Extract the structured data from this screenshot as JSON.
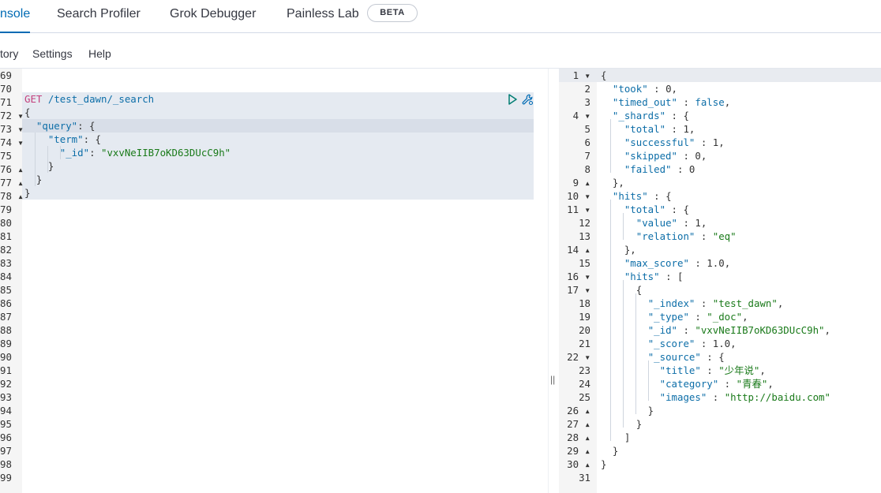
{
  "tabs": {
    "console": "nsole",
    "search_profiler": "Search Profiler",
    "grok_debugger": "Grok Debugger",
    "painless_lab": "Painless Lab",
    "beta_badge": "BETA"
  },
  "menu": {
    "history": "tory",
    "settings": "Settings",
    "help": "Help"
  },
  "request_editor": {
    "line_numbers": [
      "69",
      "70",
      "71",
      "72",
      "73",
      "74",
      "75",
      "76",
      "77",
      "78",
      "79",
      "80",
      "81",
      "82",
      "83",
      "84",
      "85",
      "86",
      "87",
      "88",
      "89",
      "90",
      "91",
      "92",
      "93",
      "94",
      "95",
      "96",
      "97",
      "98",
      "99"
    ],
    "method": "GET",
    "path": "/test_dawn/_search",
    "query_key": "\"query\"",
    "term_key": "\"term\"",
    "id_key": "\"_id\"",
    "id_value": "\"vxvNeIIB7oKD63DUcC9h\""
  },
  "response_editor": {
    "line_numbers": [
      "1",
      "2",
      "3",
      "4",
      "5",
      "6",
      "7",
      "8",
      "9",
      "10",
      "11",
      "12",
      "13",
      "14",
      "15",
      "16",
      "17",
      "18",
      "19",
      "20",
      "21",
      "22",
      "23",
      "24",
      "25",
      "26",
      "27",
      "28",
      "29",
      "30",
      "31"
    ],
    "took_key": "\"took\"",
    "took": "0",
    "timed_out_key": "\"timed_out\"",
    "timed_out": "false",
    "shards_key": "\"_shards\"",
    "total_key": "\"total\"",
    "total": "1",
    "successful_key": "\"successful\"",
    "successful": "1",
    "skipped_key": "\"skipped\"",
    "skipped": "0",
    "failed_key": "\"failed\"",
    "failed": "0",
    "hits_key": "\"hits\"",
    "value_key": "\"value\"",
    "value": "1",
    "relation_key": "\"relation\"",
    "relation": "\"eq\"",
    "max_score_key": "\"max_score\"",
    "max_score": "1.0",
    "index_key": "\"_index\"",
    "index": "\"test_dawn\"",
    "type_key": "\"_type\"",
    "type": "\"_doc\"",
    "doc_id_key": "\"_id\"",
    "doc_id": "\"vxvNeIIB7oKD63DUcC9h\"",
    "score_key": "\"_score\"",
    "score": "1.0",
    "source_key": "\"_source\"",
    "title_key": "\"title\"",
    "title": "\"少年说\"",
    "category_key": "\"category\"",
    "category": "\"青春\"",
    "images_key": "\"images\"",
    "images": "\"http://baidu.com\""
  },
  "icons": {
    "run": "play-icon",
    "settings": "wrench-icon",
    "resize": "resize-handle-icon"
  },
  "colors": {
    "accent": "#006bb4",
    "method": "#c4407c",
    "string": "#1a7a1a"
  }
}
